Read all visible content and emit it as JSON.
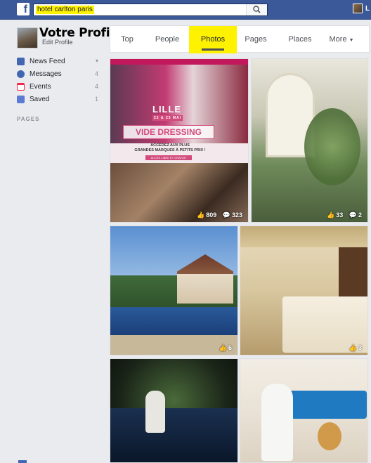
{
  "search": {
    "value": "hotel carlton paris"
  },
  "header": {
    "user_initial": "L"
  },
  "profile": {
    "name": "Votre Profil",
    "edit_label": "Edit Profile"
  },
  "sidebar": {
    "items": [
      {
        "label": "News Feed",
        "count": "",
        "icon": "news-feed-icon",
        "color": "#4267b2"
      },
      {
        "label": "Messages",
        "count": "4",
        "icon": "messages-icon",
        "color": "#4267b2"
      },
      {
        "label": "Events",
        "count": "4",
        "icon": "events-icon",
        "color": "#f02849"
      },
      {
        "label": "Saved",
        "count": "1",
        "icon": "saved-icon",
        "color": "#5b7bd5"
      }
    ],
    "pages_heading": "PAGES"
  },
  "tabs": [
    {
      "label": "Top",
      "active": false
    },
    {
      "label": "People",
      "active": false
    },
    {
      "label": "Photos",
      "active": true
    },
    {
      "label": "Pages",
      "active": false
    },
    {
      "label": "Places",
      "active": false
    },
    {
      "label": "More",
      "active": false
    }
  ],
  "photos": [
    {
      "likes": "809",
      "comments": "323",
      "text": {
        "city": "LILLE",
        "dates": "22 & 23 MAI",
        "title": "VIDE DRESSING",
        "sub1": "ACCÉDEZ AUX PLUS",
        "sub2": "GRANDES MARQUES À PETITS PRIX !",
        "badge": "ACCÈS LIBRE ET GRATUIT"
      }
    },
    {
      "likes": "33",
      "comments": "2"
    },
    {
      "likes": "6",
      "comments": ""
    },
    {
      "likes": "3",
      "comments": ""
    },
    {
      "likes": "",
      "comments": ""
    },
    {
      "likes": "",
      "comments": ""
    }
  ],
  "colors": {
    "brand": "#3b5998",
    "highlight": "#fff200"
  }
}
